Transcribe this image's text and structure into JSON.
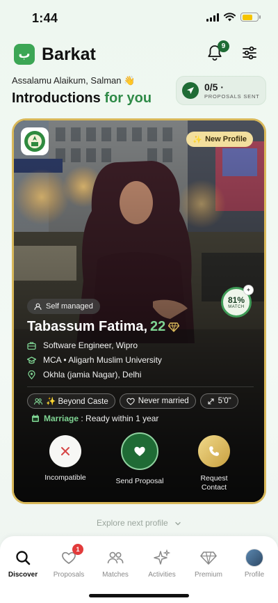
{
  "status_bar": {
    "time": "1:44"
  },
  "header": {
    "brand": "Barkat",
    "logo_letter": "ب",
    "notification_count": "9"
  },
  "greeting": "Assalamu Alaikum, Salman 👋",
  "title": {
    "main": "Introductions ",
    "accent": "for you"
  },
  "proposals_pill": {
    "count": "0/5 ·",
    "label": "PROPOSALS SENT"
  },
  "profile": {
    "badge": "New Profile",
    "match_percent": "81%",
    "match_label": "MATCH",
    "managed": "Self managed",
    "name": "Tabassum Fatima,",
    "age": "22",
    "work": "Software Engineer, Wipro",
    "education": "MCA • Aligarh Muslim University",
    "location": "Okhla (jamia Nagar), Delhi",
    "tags": [
      "✨ Beyond Caste",
      "Never married",
      "5'0\""
    ],
    "marriage_key": "Marriage",
    "marriage_value": " : Ready within 1 year"
  },
  "actions": {
    "incompatible": "Incompatible",
    "send_proposal": "Send Proposal",
    "request_contact": "Request\nContact"
  },
  "explore": "Explore next profile",
  "tabs": [
    {
      "label": "Discover",
      "icon": "search-icon",
      "active": true
    },
    {
      "label": "Proposals",
      "icon": "heart-icon",
      "badge": "1"
    },
    {
      "label": "Matches",
      "icon": "people-icon"
    },
    {
      "label": "Activities",
      "icon": "sparkles-icon"
    },
    {
      "label": "Premium",
      "icon": "diamond-icon"
    },
    {
      "label": "Profile",
      "icon": "avatar-icon"
    }
  ],
  "colors": {
    "brand_green": "#3ca655",
    "dark_green": "#1f6b35",
    "gold": "#d8b85a",
    "accent_text": "#2e8a47"
  }
}
